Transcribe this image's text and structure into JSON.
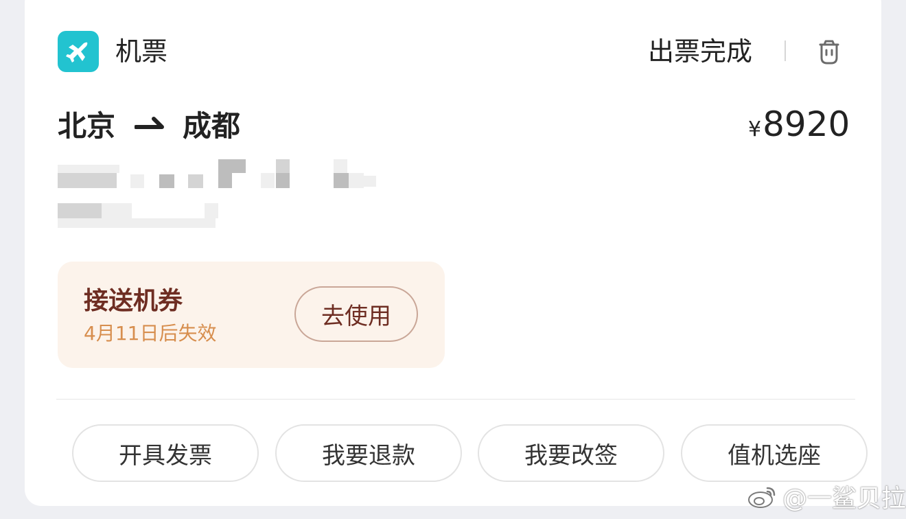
{
  "header": {
    "title": "机票",
    "status": "出票完成",
    "icon": "airplane-icon",
    "delete_icon": "trash-icon",
    "accent": "#22c3d0"
  },
  "trip": {
    "from": "北京",
    "to": "成都",
    "currency": "¥",
    "price": "8920"
  },
  "voucher": {
    "title": "接送机券",
    "expiry": "4月11日后失效",
    "button": "去使用"
  },
  "actions": [
    "开具发票",
    "我要退款",
    "我要改签",
    "值机选座"
  ],
  "watermark": "@一鲨贝拉"
}
